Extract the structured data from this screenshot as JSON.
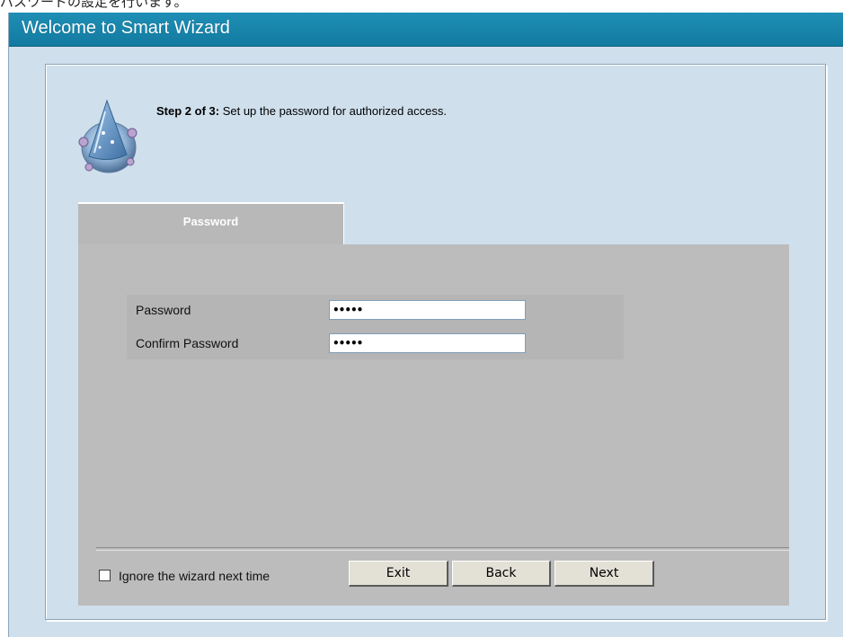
{
  "page": {
    "caption": "パスワードの設定を行います。"
  },
  "window": {
    "title": "Welcome to Smart Wizard",
    "colors": {
      "titlebar": "#1a87ad",
      "background": "#cfdfec",
      "panel_gray": "#bcbcbc"
    }
  },
  "step": {
    "prefix": "Step 2 of 3:",
    "text": " Set up the password for authorized access."
  },
  "tab": {
    "label": "Password"
  },
  "form": {
    "password_label": "Password",
    "password_value": "•••••",
    "confirm_label": "Confirm Password",
    "confirm_value": "•••••"
  },
  "footer": {
    "ignore_label": "Ignore the wizard next time",
    "ignore_checked": false,
    "exit_label": "Exit",
    "back_label": "Back",
    "next_label": "Next"
  },
  "icons": {
    "wizard": "wizard-hat-icon"
  }
}
